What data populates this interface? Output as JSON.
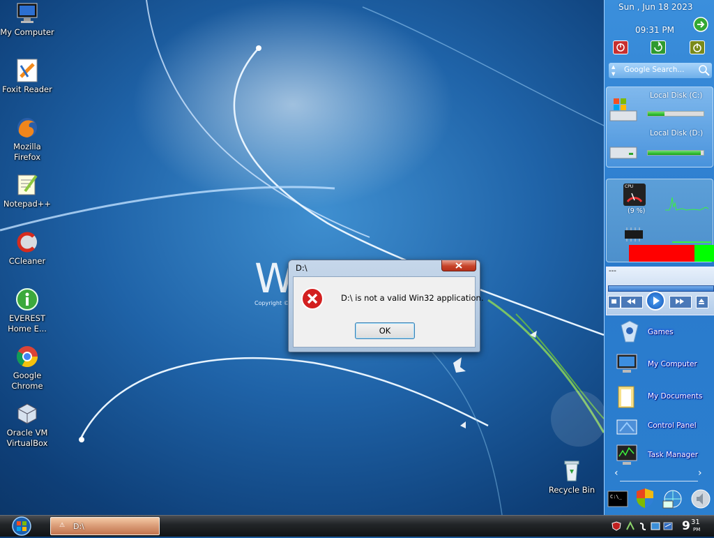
{
  "desktop": {
    "icons": [
      {
        "label": "My Computer"
      },
      {
        "label": "Foxit Reader"
      },
      {
        "label": "Mozilla Firefox"
      },
      {
        "label": "Notepad++"
      },
      {
        "label": "CCleaner"
      },
      {
        "label": "EVEREST Home E..."
      },
      {
        "label": "Google Chrome"
      },
      {
        "label": "Oracle VM VirtualBox"
      },
      {
        "label": "Recycle Bin"
      }
    ],
    "wallpaper_logo": "Windows",
    "wallpaper_copyright": "Copyright ©"
  },
  "sidebar": {
    "date": "Sun , Jun 18 2023",
    "time": "09:31 PM",
    "search_placeholder": "Google Search...",
    "drives": [
      {
        "label": "Local Disk (C:)",
        "fill": 0.3
      },
      {
        "label": "Local Disk (D:)",
        "fill": 0.95
      }
    ],
    "cpu": {
      "label": "CPU",
      "value": "(9 %)"
    },
    "media_title": "---",
    "launch_items": [
      {
        "label": "Games"
      },
      {
        "label": "My Computer"
      },
      {
        "label": "My Documents"
      },
      {
        "label": "Control Panel"
      },
      {
        "label": "Task Manager"
      }
    ]
  },
  "dialog": {
    "title": "D:\\",
    "message": "D:\\ is not a valid Win32 application.",
    "ok_label": "OK"
  },
  "taskbar": {
    "task_label": "D:\\",
    "clock_hour": "9",
    "clock_min": "31",
    "clock_ampm": "PM"
  },
  "colors": {
    "accent": "#2a7acc",
    "error": "#d32020",
    "ok_border": "#3c7fb1"
  }
}
